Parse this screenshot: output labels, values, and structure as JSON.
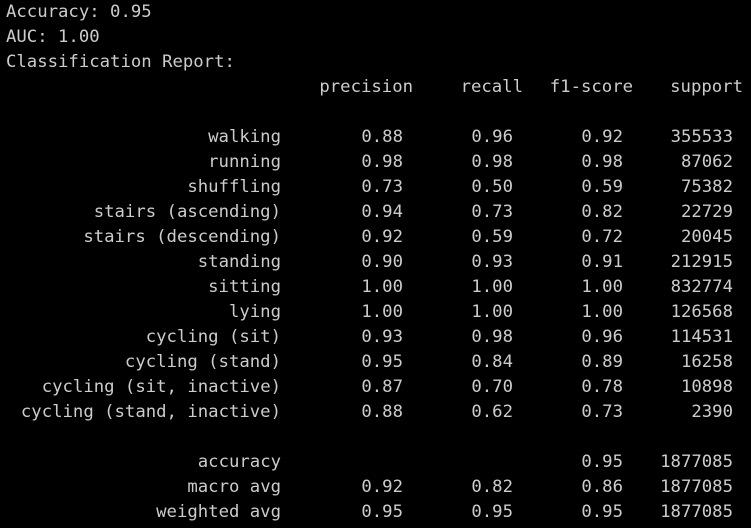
{
  "output": {
    "accuracy_line": "Accuracy: 0.95",
    "auc_line": "AUC: 1.00",
    "report_title": "Classification Report:"
  },
  "report": {
    "headers": {
      "precision": "precision",
      "recall": "recall",
      "f1": "f1-score",
      "support": "support"
    },
    "rows": [
      {
        "label": "walking",
        "precision": "0.88",
        "recall": "0.96",
        "f1": "0.92",
        "support": "355533"
      },
      {
        "label": "running",
        "precision": "0.98",
        "recall": "0.98",
        "f1": "0.98",
        "support": "87062"
      },
      {
        "label": "shuffling",
        "precision": "0.73",
        "recall": "0.50",
        "f1": "0.59",
        "support": "75382"
      },
      {
        "label": "stairs (ascending)",
        "precision": "0.94",
        "recall": "0.73",
        "f1": "0.82",
        "support": "22729"
      },
      {
        "label": "stairs (descending)",
        "precision": "0.92",
        "recall": "0.59",
        "f1": "0.72",
        "support": "20045"
      },
      {
        "label": "standing",
        "precision": "0.90",
        "recall": "0.93",
        "f1": "0.91",
        "support": "212915"
      },
      {
        "label": "sitting",
        "precision": "1.00",
        "recall": "1.00",
        "f1": "1.00",
        "support": "832774"
      },
      {
        "label": "lying",
        "precision": "1.00",
        "recall": "1.00",
        "f1": "1.00",
        "support": "126568"
      },
      {
        "label": "cycling (sit)",
        "precision": "0.93",
        "recall": "0.98",
        "f1": "0.96",
        "support": "114531"
      },
      {
        "label": "cycling (stand)",
        "precision": "0.95",
        "recall": "0.84",
        "f1": "0.89",
        "support": "16258"
      },
      {
        "label": "cycling (sit, inactive)",
        "precision": "0.87",
        "recall": "0.70",
        "f1": "0.78",
        "support": "10898"
      },
      {
        "label": "cycling (stand, inactive)",
        "precision": "0.88",
        "recall": "0.62",
        "f1": "0.73",
        "support": "2390"
      }
    ],
    "summary": [
      {
        "label": "accuracy",
        "precision": "",
        "recall": "",
        "f1": "0.95",
        "support": "1877085"
      },
      {
        "label": "macro avg",
        "precision": "0.92",
        "recall": "0.82",
        "f1": "0.86",
        "support": "1877085"
      },
      {
        "label": "weighted avg",
        "precision": "0.95",
        "recall": "0.95",
        "f1": "0.95",
        "support": "1877085"
      }
    ]
  },
  "colors": {
    "background": "#000000",
    "text": "#cccccc"
  }
}
